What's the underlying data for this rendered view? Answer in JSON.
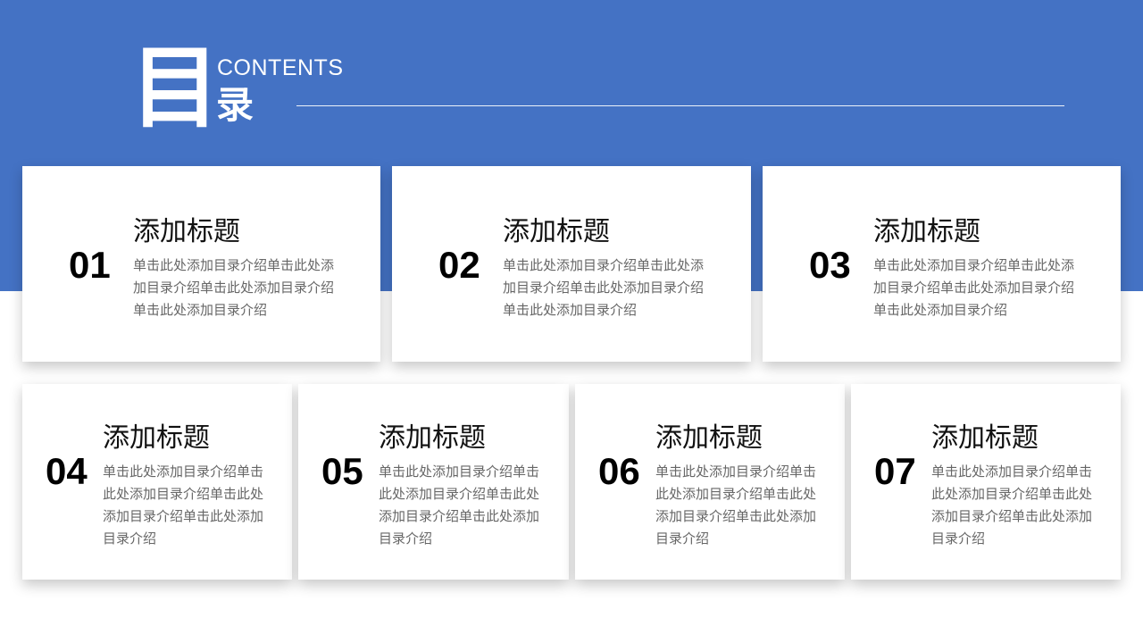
{
  "header": {
    "title_big": "目",
    "title_en": "CONTENTS",
    "title_cn": "录"
  },
  "cards": [
    {
      "number": "01",
      "title": "添加标题",
      "description": "单击此处添加目录介绍单击此处添加目录介绍单击此处添加目录介绍单击此处添加目录介绍"
    },
    {
      "number": "02",
      "title": "添加标题",
      "description": "单击此处添加目录介绍单击此处添加目录介绍单击此处添加目录介绍单击此处添加目录介绍"
    },
    {
      "number": "03",
      "title": "添加标题",
      "description": "单击此处添加目录介绍单击此处添加目录介绍单击此处添加目录介绍单击此处添加目录介绍"
    },
    {
      "number": "04",
      "title": "添加标题",
      "description": "单击此处添加目录介绍单击此处添加目录介绍单击此处添加目录介绍单击此处添加目录介绍"
    },
    {
      "number": "05",
      "title": "添加标题",
      "description": "单击此处添加目录介绍单击此处添加目录介绍单击此处添加目录介绍单击此处添加目录介绍"
    },
    {
      "number": "06",
      "title": "添加标题",
      "description": "单击此处添加目录介绍单击此处添加目录介绍单击此处添加目录介绍单击此处添加目录介绍"
    },
    {
      "number": "07",
      "title": "添加标题",
      "description": "单击此处添加目录介绍单击此处添加目录介绍单击此处添加目录介绍单击此处添加目录介绍"
    }
  ],
  "colors": {
    "accent": "#4472c4",
    "card": "#ffffff",
    "number": "#000000",
    "description": "#666666"
  }
}
